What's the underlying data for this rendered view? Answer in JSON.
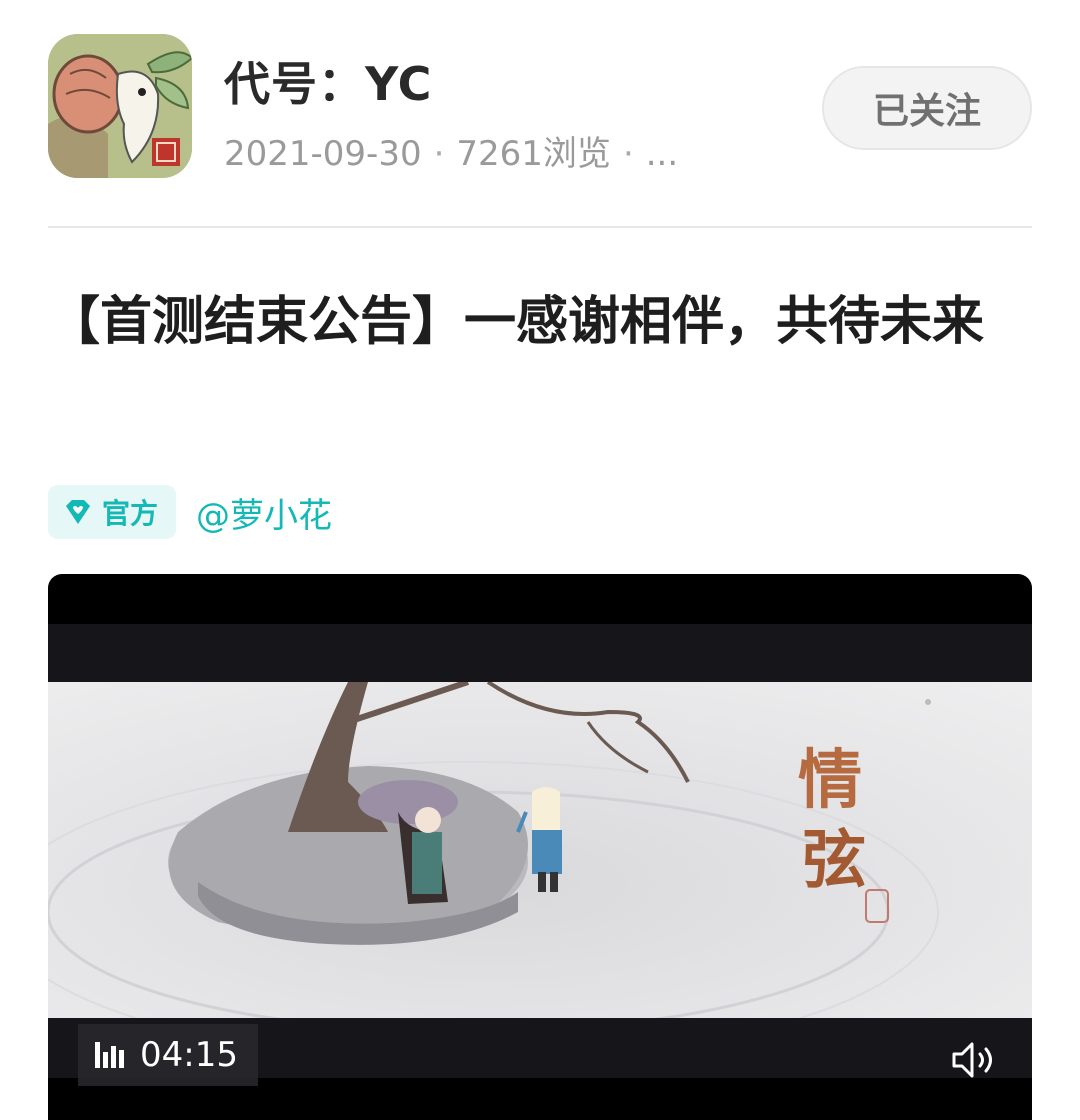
{
  "header": {
    "game_name": "代号：YC",
    "date": "2021-09-30",
    "views": "7261浏览",
    "more": "...",
    "follow_label": "已关注",
    "separator": "·"
  },
  "post": {
    "title": "【首测结束公告】一感谢相伴，共待未来",
    "badge_label": "官方",
    "author": "@萝小花"
  },
  "video": {
    "duration": "04:15",
    "caption_art": "情弦",
    "icons": {
      "badge": "diamond-heart-icon",
      "duration": "audio-bars-icon",
      "volume": "speaker-icon"
    }
  },
  "colors": {
    "accent": "#14b8b5",
    "badge_bg": "#e5f7f7",
    "muted_text": "#9a9a9a"
  }
}
